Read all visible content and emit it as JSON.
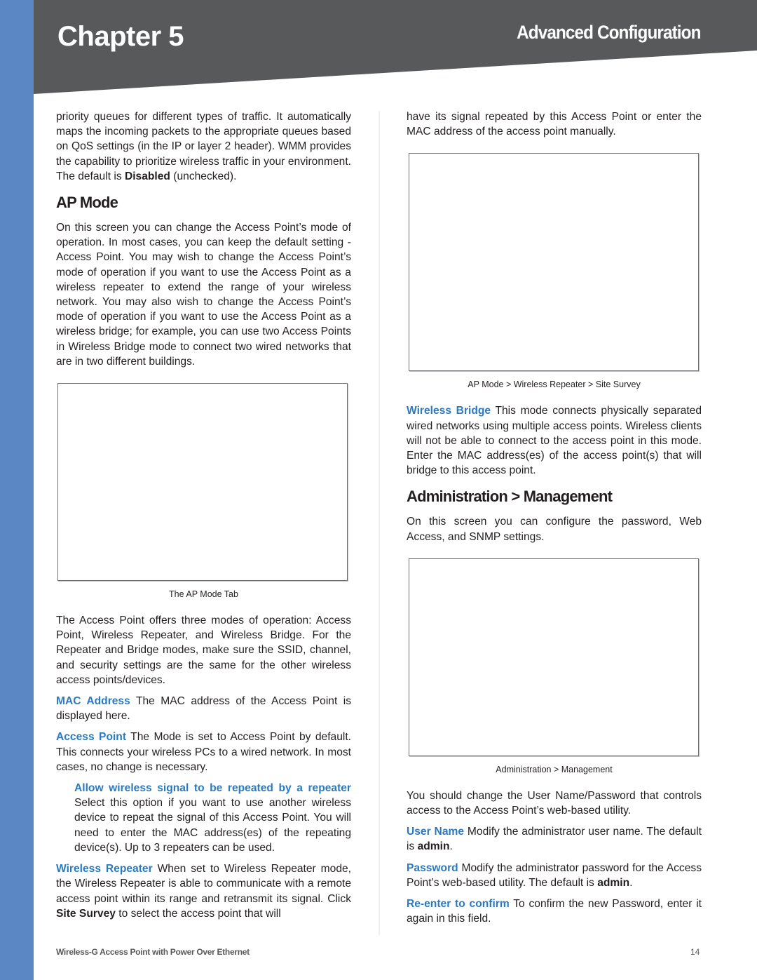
{
  "header": {
    "chapter": "Chapter 5",
    "section": "Advanced Configuration",
    "colors": {
      "banner": "#58595b",
      "strip": "#5b87c5",
      "accent": "#2b7ac0"
    }
  },
  "left_column": {
    "intro_paragraph": {
      "text_before": "priority queues for different types of traffic. It automatically maps the incoming packets to the appropriate queues based on QoS settings (in the IP or layer 2 header). WMM provides the capability to prioritize wireless traffic in your environment. The default is ",
      "bold": "Disabled",
      "text_after": " (unchecked)."
    },
    "ap_mode_heading": "AP Mode",
    "ap_mode_paragraph": "On this screen you can change the Access Point’s mode of operation. In most cases, you can keep the default setting - Access Point. You may wish to change the Access Point’s mode of operation if you want to use the Access Point as a wireless repeater to extend the range of your wireless network. You may also wish to change the Access Point’s mode of operation if you want to use the Access Point as a wireless bridge; for example, you can use two Access Points in Wireless Bridge mode to connect two wired networks that are in two different buildings.",
    "figure_caption": "The AP Mode Tab",
    "modes_paragraph": "The Access Point offers three modes of operation: Access Point, Wireless Repeater, and Wireless Bridge. For the Repeater and Bridge modes, make sure the SSID, channel, and security settings are the same for the other wireless access points/devices.",
    "mac_address": {
      "term": "MAC Address",
      "text": " The MAC address of the Access Point is displayed here."
    },
    "access_point": {
      "term": "Access Point",
      "text": "  The Mode is set to Access Point by default. This connects your wireless PCs to a wired network. In most cases, no change is necessary."
    },
    "allow_repeat": {
      "term": "Allow wireless signal to be repeated by a repeater",
      "text": "  Select this option if you want to use another wireless device to repeat the signal of this Access Point. You will need to enter the MAC address(es) of the repeating device(s). Up to 3 repeaters can be used."
    },
    "wireless_repeater": {
      "term": "Wireless Repeater",
      "text": "  When set to Wireless Repeater mode, the Wireless Repeater is able to communicate with a remote access point within its range and retransmit its signal. Click ",
      "bold": "Site Survey",
      "text_after": " to select the access point that will"
    }
  },
  "right_column": {
    "continued_paragraph": "have its signal repeated by this Access Point or enter the MAC address of the access point manually.",
    "figure1_caption": "AP Mode > Wireless Repeater > Site Survey",
    "wireless_bridge": {
      "term": "Wireless Bridge",
      "text": "  This mode connects physically separated wired networks using multiple access points. Wireless clients will not be able to connect to the access point in this mode. Enter the MAC address(es) of the access point(s) that will bridge to this access point."
    },
    "admin_heading": "Administration > Management",
    "admin_paragraph": "On this screen you can configure the password, Web Access, and SNMP settings.",
    "figure2_caption": "Administration > Management",
    "change_paragraph": "You should change the User Name/Password that controls access to the Access Point’s web-based utility.",
    "user_name": {
      "term": "User Name",
      "text": " Modify the administrator user name. The default is ",
      "bold": "admin",
      "text_after": "."
    },
    "password": {
      "term": "Password",
      "text": " Modify the administrator password for the Access Point’s web-based utility. The default is ",
      "bold": "admin",
      "text_after": "."
    },
    "reenter": {
      "term": "Re-enter to confirm",
      "text": "  To confirm the new Password, enter it again in this field."
    }
  },
  "footer": {
    "product": "Wireless-G Access Point with  Power Over Ethernet",
    "page_number": "14"
  }
}
